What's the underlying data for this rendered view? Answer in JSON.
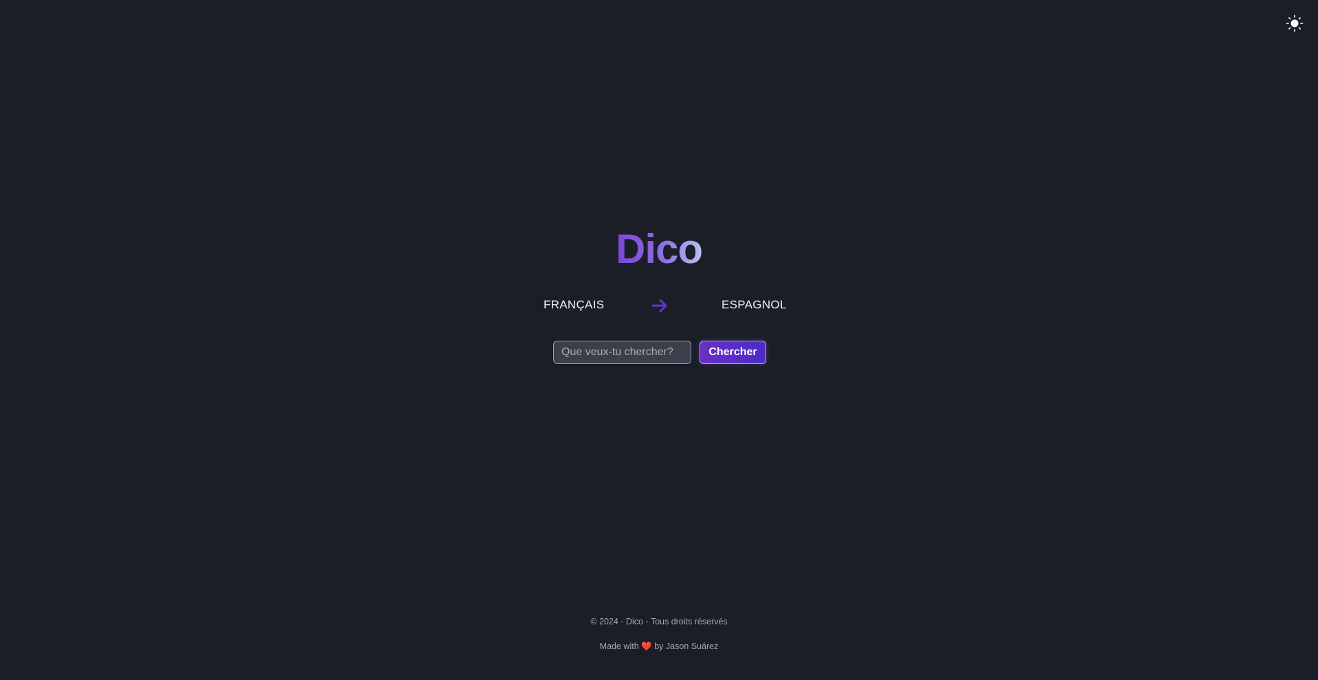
{
  "header": {
    "theme_toggle_icon": "sun-icon"
  },
  "app": {
    "title": "Dico"
  },
  "languages": {
    "source": "FRANÇAIS",
    "target": "ESPAGNOL",
    "swap_icon": "arrow-right-icon",
    "accent_color": "#6b2fd6"
  },
  "search": {
    "placeholder": "Que veux-tu chercher?",
    "value": "",
    "button_label": "Chercher"
  },
  "footer": {
    "copyright": "© 2024 - Dico - Tous droits réservés",
    "made_with_prefix": "Made with",
    "heart_icon": "heart-icon",
    "heart_glyph": "❤️",
    "made_with_suffix": "by Jason Suárez"
  }
}
